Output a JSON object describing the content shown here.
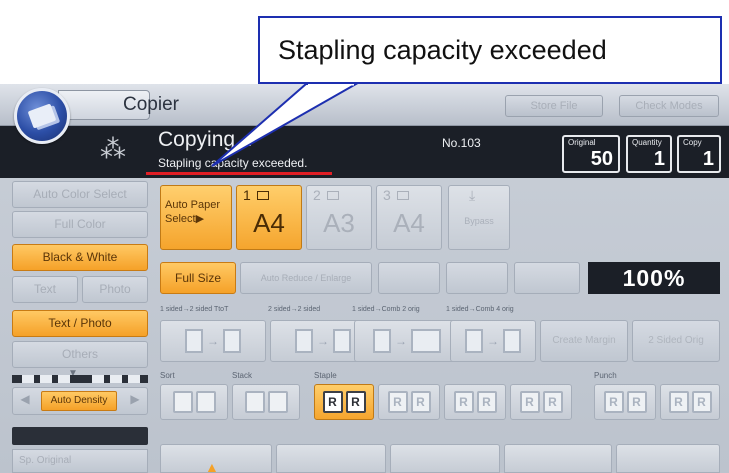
{
  "callout": {
    "text": "Stapling capacity exceeded"
  },
  "header": {
    "app_title": "Copier",
    "store_file": "Store File",
    "check_modes": "Check Modes"
  },
  "status": {
    "title": "Copying...",
    "message": "Stapling capacity exceeded.",
    "job_number": "No.103"
  },
  "counters": {
    "original": {
      "label": "Original",
      "value": "50"
    },
    "quantity": {
      "label": "Quantity",
      "value": "1"
    },
    "copy": {
      "label": "Copy",
      "value": "1"
    }
  },
  "color_modes": {
    "auto_color_select": "Auto Color Select",
    "full_color": "Full Color",
    "black_white": "Black & White",
    "text": "Text",
    "photo": "Photo",
    "text_photo": "Text / Photo",
    "others": "Others"
  },
  "paper": {
    "auto_paper_select": "Auto Paper Select▶",
    "trays": [
      {
        "num": "1",
        "size": "A4",
        "selected": true
      },
      {
        "num": "2",
        "size": "A3",
        "selected": false
      },
      {
        "num": "3",
        "size": "A4",
        "selected": false
      }
    ],
    "bypass": "Bypass"
  },
  "reduce_enlarge": {
    "full_size": "Full Size",
    "auto_reduce_enlarge": "Auto Reduce / Enlarge",
    "zoom_value": "100%"
  },
  "duplex": {
    "labels": [
      "1 sided→2 sided TtoT",
      "2 sided→2 sided",
      "1 sided→Comb 2 orig",
      "1 sided→Comb 4 orig"
    ],
    "create_margin": "Create Margin",
    "dup_cover": "2 Sided Orig"
  },
  "density": {
    "auto_density": "Auto Density"
  },
  "finishing": {
    "sort": "Sort",
    "stack": "Stack",
    "staple": "Staple",
    "punch": "Punch",
    "staple_glyph": "R"
  },
  "bottom": {
    "special_original": "Sp. Original"
  },
  "colors": {
    "accent_orange": "#f5a128",
    "status_bar": "#1b1f27",
    "callout_border": "#1d2fb0",
    "error_underline": "#e01e25"
  }
}
